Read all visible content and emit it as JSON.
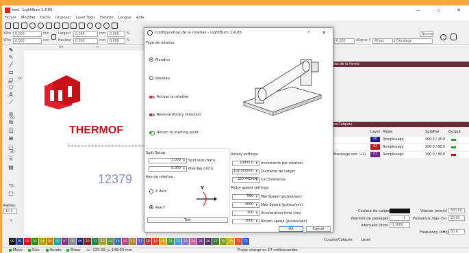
{
  "window": {
    "title": "test - LightBurn 1.4.05"
  },
  "menu": [
    "Fichier",
    "Modifier",
    "Outils",
    "Disposer",
    "Laser Tools",
    "Fenêtre",
    "Langue",
    "Aide"
  ],
  "props": {
    "xpos_label": "XPos",
    "xpos_value": "0.000",
    "ypos_label": "YPos",
    "ypos_value": "0.000",
    "unit": "mm",
    "width_label": "Largeur",
    "width_value": "0.000",
    "height_label": "Hauteur",
    "height_value": "0.000",
    "percent": "%",
    "align_x": "Aligner X",
    "align_y": "Aligner Y",
    "milieu": "Milieu",
    "normal": "Normal",
    "decalage": "Décalage",
    "zero": "0"
  },
  "canvas": {
    "ruler_top": [
      "-20",
      "0"
    ],
    "ruler_left": [
      "100",
      "80",
      "60",
      "40",
      "20",
      "0"
    ],
    "thermo_text": "THERMOF",
    "number_text": "12379"
  },
  "left_tools": {
    "radius_label": "Radius:",
    "radius_value": "10.0"
  },
  "dialog": {
    "title": "Configuration de la rotative - LightBurn 1.4.05",
    "help": "?",
    "close": "✕",
    "type_label": "Type de rotative",
    "mandrin": "Mandrin",
    "rouleau": "Rouleau",
    "activate": "Activer la rotative",
    "reverse": "Reverse Rotary Direction",
    "return": "Return to starting point",
    "split_setup": "Split Setup",
    "split_size_value": "2.000",
    "split_size_label": "Split size (mm)",
    "overlap_value": "0.000",
    "overlap_label": "Overlap (mm)",
    "axe_label": "Axe de rotative",
    "x_axis": "X Axis",
    "y_axis": "Axe Y",
    "y_glyph": "Y",
    "test": "Test",
    "rotary_settings": "Rotary settings:",
    "steps_value": "10000.0",
    "steps_label": "increments par rotation",
    "diameter_value": "102.000mm",
    "diameter_label": "Diamètre de l'objet",
    "circ_value": "320.442mm",
    "circ_label": "Circonférence",
    "motor_label": "Motor speed settings:",
    "min_value": "500",
    "min_label": "Min Speed (pulses/sec)",
    "max_value": "3000",
    "max_label": "Max Speed (pulses/sec)",
    "accel_value": "100",
    "accel_label": "Acceleration time (ms)",
    "ret_value": "3000",
    "ret_label": "Return speed (pulses/sec)",
    "ok": "OK",
    "cancel": "Cancel"
  },
  "right": {
    "forme_head": "tés de la forme",
    "calques_head": "es/Calques",
    "col_layer": "Layer",
    "col_mode": "Mode",
    "col_spd": "Spd/Pwr",
    "col_output": "Output",
    "layers": [
      {
        "num": "00",
        "mode": "Remplissage",
        "spd": "300.0 / 20.0",
        "color": "#1a1a8a",
        "name": ""
      },
      {
        "num": "02",
        "mode": "Remplissage",
        "spd": "300.0 / 80.0",
        "color": "#c01818",
        "name": ""
      },
      {
        "num": "07",
        "mode": "Remplissage",
        "spd": "100.0 / 80.0",
        "color": "#6a2a8a",
        "name": "Marquage noir (+2)"
      }
    ],
    "couleur": "Couleur de calque",
    "vitesse": "Vitesse (mm/s)",
    "vitesse_value": "300,00",
    "passes": "Nombre de passages",
    "passes_value": "1",
    "puissance": "Puissance max (%)",
    "puissance_value": "20,00",
    "intervalle": "Intervalle (mm)",
    "intervalle_value": "0.1000",
    "frequence": "Frequency (kHz)",
    "frequence_value": "30,0",
    "tab1": "Coupes/Calques",
    "tab2": "Laser"
  },
  "palette": [
    {
      "n": "00",
      "c": "#111111"
    },
    {
      "n": "01",
      "c": "#1a3aa0"
    },
    {
      "n": "02",
      "c": "#c8101a"
    },
    {
      "n": "03",
      "c": "#2a8a2a"
    },
    {
      "n": "04",
      "c": "#b09a20"
    },
    {
      "n": "05",
      "c": "#d07a10"
    },
    {
      "n": "06",
      "c": "#20a0a0"
    },
    {
      "n": "07",
      "c": "#8a2a8a"
    },
    {
      "n": "08",
      "c": "#888888"
    },
    {
      "n": "09",
      "c": "#202080"
    },
    {
      "n": "10",
      "c": "#802020"
    },
    {
      "n": "11",
      "c": "#208040"
    },
    {
      "n": "12",
      "c": "#a0a040"
    },
    {
      "n": "13",
      "c": "#609050"
    },
    {
      "n": "14",
      "c": "#3070c0"
    },
    {
      "n": "15",
      "c": "#c04080"
    },
    {
      "n": "16",
      "c": "#c08040"
    },
    {
      "n": "17",
      "c": "#6060c0"
    },
    {
      "n": "18",
      "c": "#a04040"
    },
    {
      "n": "19",
      "c": "#e04040"
    },
    {
      "n": "20",
      "c": "#e0a020"
    },
    {
      "n": "21",
      "c": "#40a040"
    },
    {
      "n": "22",
      "c": "#40a0c0"
    },
    {
      "n": "23",
      "c": "#9070d0"
    },
    {
      "n": "24",
      "c": "#d060a0"
    },
    {
      "n": "25",
      "c": "#7a3a8a"
    },
    {
      "n": "26",
      "c": "#5a2a6a"
    },
    {
      "n": "27",
      "c": "#3a7a3a"
    },
    {
      "n": "28",
      "c": "#7aa02a"
    },
    {
      "n": "29",
      "c": "#d0b020"
    },
    {
      "n": "T1",
      "c": "#e05030"
    },
    {
      "n": "T2",
      "c": "#3060d0"
    }
  ],
  "status": {
    "move": "Move",
    "size": "Size",
    "rotate": "Rotate",
    "shear": "Shear",
    "coords": "x: -125.00, y: 149.00 mm",
    "message": "Projet chargé en 17 millisecondes"
  }
}
